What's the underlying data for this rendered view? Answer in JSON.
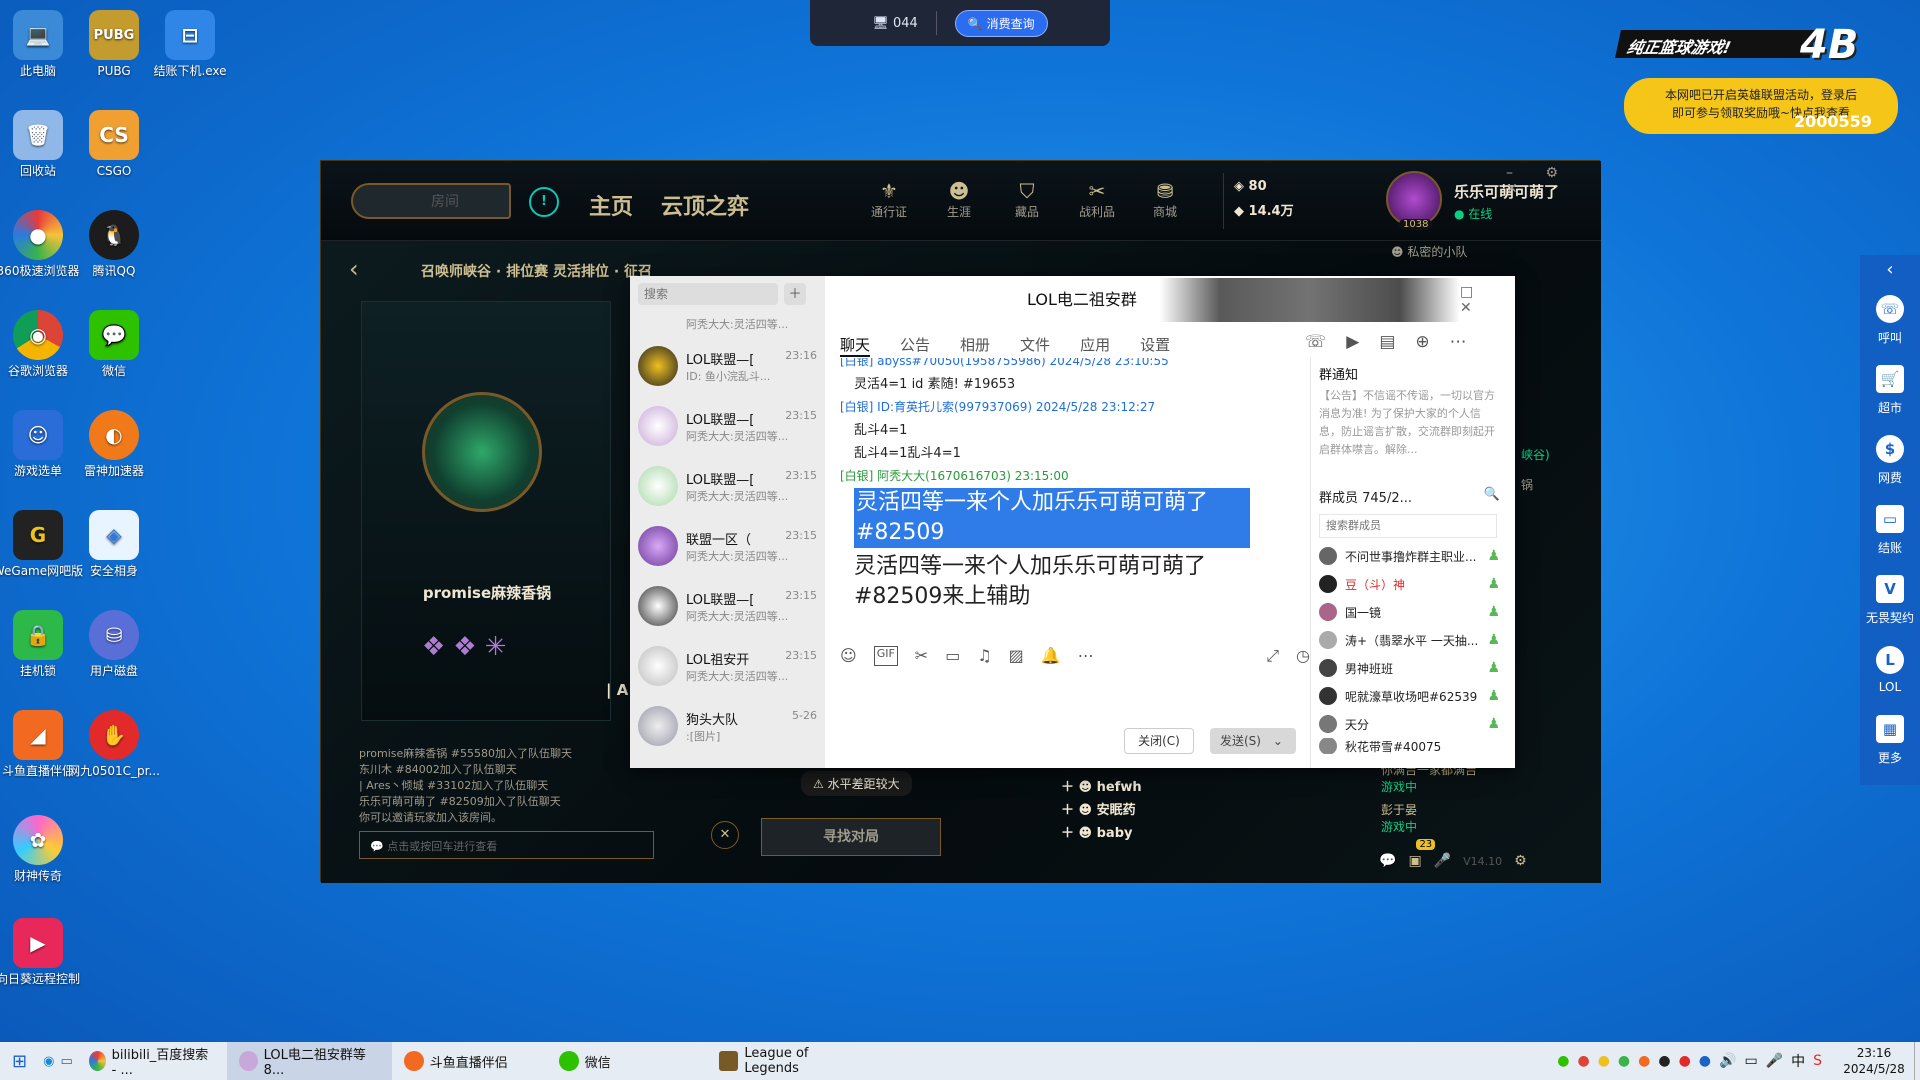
{
  "desktop": {
    "icons": [
      {
        "label": "此电脑"
      },
      {
        "label": "PUBG"
      },
      {
        "label": "结账下机.exe"
      },
      {
        "label": "回收站"
      },
      {
        "label": "CSGO"
      },
      {
        "label": "360极速浏览器"
      },
      {
        "label": "腾讯QQ"
      },
      {
        "label": "谷歌浏览器"
      },
      {
        "label": "微信"
      },
      {
        "label": "游戏选单"
      },
      {
        "label": "雷神加速器"
      },
      {
        "label": "WeGame网吧版"
      },
      {
        "label": "安全相身"
      },
      {
        "label": "挂机锁"
      },
      {
        "label": "用户磁盘"
      },
      {
        "label": "斗鱼直播伴侣"
      },
      {
        "label": "网九0501C_pr..."
      },
      {
        "label": "财神传奇"
      },
      {
        "label": "向日葵远程控制"
      }
    ]
  },
  "topbar": {
    "machine": "044",
    "query_button": "消费查询"
  },
  "ad": {
    "title": "纯正篮球游戏!",
    "line1": "本网吧已开启英雄联盟活动，登录后",
    "line2": "即可参与领取奖励哦~快点我查看",
    "number": "2000559"
  },
  "side_panel": {
    "items": [
      {
        "label": "呼叫"
      },
      {
        "label": "超市"
      },
      {
        "label": "网费"
      },
      {
        "label": "结账"
      },
      {
        "label": "无畏契约"
      },
      {
        "label": "LOL"
      },
      {
        "label": "更多"
      }
    ]
  },
  "lol": {
    "room_placeholder": "房间",
    "nav": {
      "home": "主页",
      "tft": "云顶之弈"
    },
    "icons": [
      {
        "label": "通行证"
      },
      {
        "label": "生涯"
      },
      {
        "label": "藏品"
      },
      {
        "label": "战利品"
      },
      {
        "label": "商城"
      }
    ],
    "currency": {
      "rp": "80",
      "be": "14.4万"
    },
    "profile": {
      "name": "乐乐可萌可萌了",
      "status": "在线",
      "level": "1038"
    },
    "party_label": "私密的小队",
    "queue": "召唤师峡谷 · 排位赛 灵活排位 · 征召",
    "player_name": "promise麻辣香锅",
    "player2_partial": "| A",
    "lobby_chat": [
      "promise麻辣香锅 #55580加入了队伍聊天",
      "东川木 #84002加入了队伍聊天",
      "| Ares丶倾城 #33102加入了队伍聊天",
      "乐乐可萌可萌了 #82509加入了队伍聊天",
      "你可以邀请玩家加入该房间。"
    ],
    "chat_input_placeholder": "点击或按回车进行查看",
    "warning": "水平差距较大",
    "find_match": "寻找对局",
    "friends": [
      {
        "name": "hefwh"
      },
      {
        "name": "安眠药"
      },
      {
        "name": "baby"
      }
    ],
    "right_friends": [
      {
        "name": "你满吉一家都满吉",
        "status": "游戏中"
      },
      {
        "name": "彭于晏",
        "status": "游戏中"
      }
    ],
    "side_text": [
      "峡谷)",
      "锅"
    ],
    "badge": "23",
    "version": "V14.10"
  },
  "qq": {
    "title": "LOL电二祖安群",
    "search_placeholder": "搜索",
    "tabs": [
      "聊天",
      "公告",
      "相册",
      "文件",
      "应用",
      "设置"
    ],
    "conversations": [
      {
        "name": "",
        "time": "",
        "snippet": "阿秃大大:灵活四等..."
      },
      {
        "name": "LOL联盟—[",
        "time": "23:16",
        "snippet": "ID: 鱼小浣乱斗..."
      },
      {
        "name": "LOL联盟—[",
        "time": "23:15",
        "snippet": "阿秃大大:灵活四等..."
      },
      {
        "name": "LOL联盟—[",
        "time": "23:15",
        "snippet": "阿秃大大:灵活四等..."
      },
      {
        "name": "联盟一区（",
        "time": "23:15",
        "snippet": "阿秃大大:灵活四等..."
      },
      {
        "name": "LOL联盟—[",
        "time": "23:15",
        "snippet": "阿秃大大:灵活四等..."
      },
      {
        "name": "LOL祖安开",
        "time": "23:15",
        "snippet": "阿秃大大:灵活四等..."
      },
      {
        "name": "狗头大队",
        "time": "5-26",
        "snippet": ":[图片]"
      }
    ],
    "messages": [
      {
        "header": "[白银] abyss#70050(1958755986) 2024/5/28 23:10:55",
        "body": "灵活4=1  id 素随! #19653"
      },
      {
        "header": "[白银] ID:育英托儿索(997937069) 2024/5/28 23:12:27",
        "body": "乱斗4=1"
      },
      {
        "header": "",
        "body": "乱斗4=1乱斗4=1"
      },
      {
        "header": "[白银] 阿秃大大(1670616703)  23:15:00",
        "body": ""
      }
    ],
    "highlight_msg": "灵活四等一来个人加乐乐可萌可萌了#82509",
    "big_msg": "灵活四等一来个人加乐乐可萌可萌了#82509来上辅助",
    "notice_title": "群通知",
    "notice_text": "【公告】不信谣不传谣，一切以官方消息为准! 为了保护大家的个人信息，防止谣言扩散，交流群即刻起开启群体噤言。解除...",
    "member_count": "群成员 745/2...",
    "member_search": "搜索群成员",
    "members": [
      {
        "name": "不问世事撸炸群主职业..."
      },
      {
        "name": "豆（斗）神"
      },
      {
        "name": "国一镜"
      },
      {
        "name": "涛+（翡翠水平 一天抽..."
      },
      {
        "name": "男神班班"
      },
      {
        "name": "呢就濠草收场吧#62539"
      },
      {
        "name": "天分"
      },
      {
        "name": "秋花带雪#40075"
      }
    ],
    "close_btn": "关闭(C)",
    "send_btn": "发送(S)"
  },
  "taskbar": {
    "items": [
      {
        "label": "bilibili_百度搜索 - ..."
      },
      {
        "label": "LOL电二祖安群等8..."
      },
      {
        "label": "斗鱼直播伴侣"
      },
      {
        "label": "微信"
      },
      {
        "label": "League of Legends"
      }
    ],
    "time": "23:16",
    "date": "2024/5/28"
  }
}
